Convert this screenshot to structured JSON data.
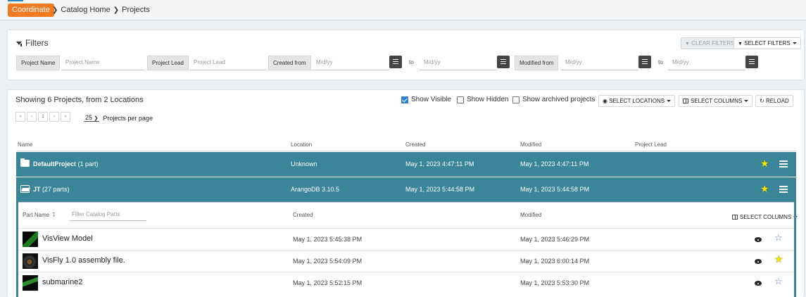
{
  "topbar": {
    "brand_button": "Coordinate",
    "breadcrumb": [
      "Catalog Home",
      "Projects"
    ],
    "accent_color": "#f07b22"
  },
  "filters": {
    "title": "Filters",
    "clear_button": "CLEAR FILTERS",
    "select_button": "SELECT FILTERS",
    "fields": {
      "project_name_label": "Project Name",
      "project_name_placeholder": "Project Name",
      "project_lead_label": "Project Lead",
      "project_lead_placeholder": "Project Lead",
      "created_from_label": "Created from",
      "date_placeholder": "M/d/yy",
      "to_label": "to",
      "modified_from_label": "Modified from"
    }
  },
  "projects": {
    "showing_text": "Showing 6 Projects, from 2 Locations",
    "show_visible": "Show Visible",
    "show_hidden": "Show Hidden",
    "show_archived": "Show archived projects",
    "select_locations": "SELECT LOCATIONS",
    "select_columns": "SELECT COLUMNS",
    "reload": "RELOAD",
    "pager": {
      "first": "«",
      "prev": "‹",
      "page": "1",
      "next": "›",
      "last": "»"
    },
    "per_page_value": "25",
    "per_page_label": "Projects per page",
    "columns": [
      "Name",
      "Location",
      "Created",
      "Modified",
      "Project Lead"
    ],
    "rows": [
      {
        "name": "DefaultProject",
        "suffix": "(1 part)",
        "location": "Unknown",
        "created": "May 1, 2023 4:47:11 PM",
        "modified": "May 1, 2023 4:47:11 PM"
      },
      {
        "name": "JT",
        "suffix": "(27 parts)",
        "location": "ArangoDB 3.10.5",
        "created": "May 1, 2023 5:44:58 PM",
        "modified": "May 1, 2023 5:44:58 PM"
      }
    ],
    "row_color": "#3a8598"
  },
  "parts": {
    "columns": [
      "Part Name",
      "Created",
      "Modified"
    ],
    "filter_placeholder": "Filter Catalog Parts",
    "select_columns": "SELECT COLUMNS",
    "rows": [
      {
        "name": "VisView Model",
        "created": "May 1, 2023 5:45:38 PM",
        "modified": "May 1, 2023 5:46:29 PM",
        "favorite": false
      },
      {
        "name": "VisFly 1.0 assembly file.",
        "created": "May 1, 2023 5:54:09 PM",
        "modified": "May 1, 2023 6:00:14 PM",
        "favorite": true
      },
      {
        "name": "submarine2",
        "created": "May 1, 2023 5:52:15 PM",
        "modified": "May 1, 2023 5:53:30 PM",
        "favorite": false
      }
    ]
  }
}
